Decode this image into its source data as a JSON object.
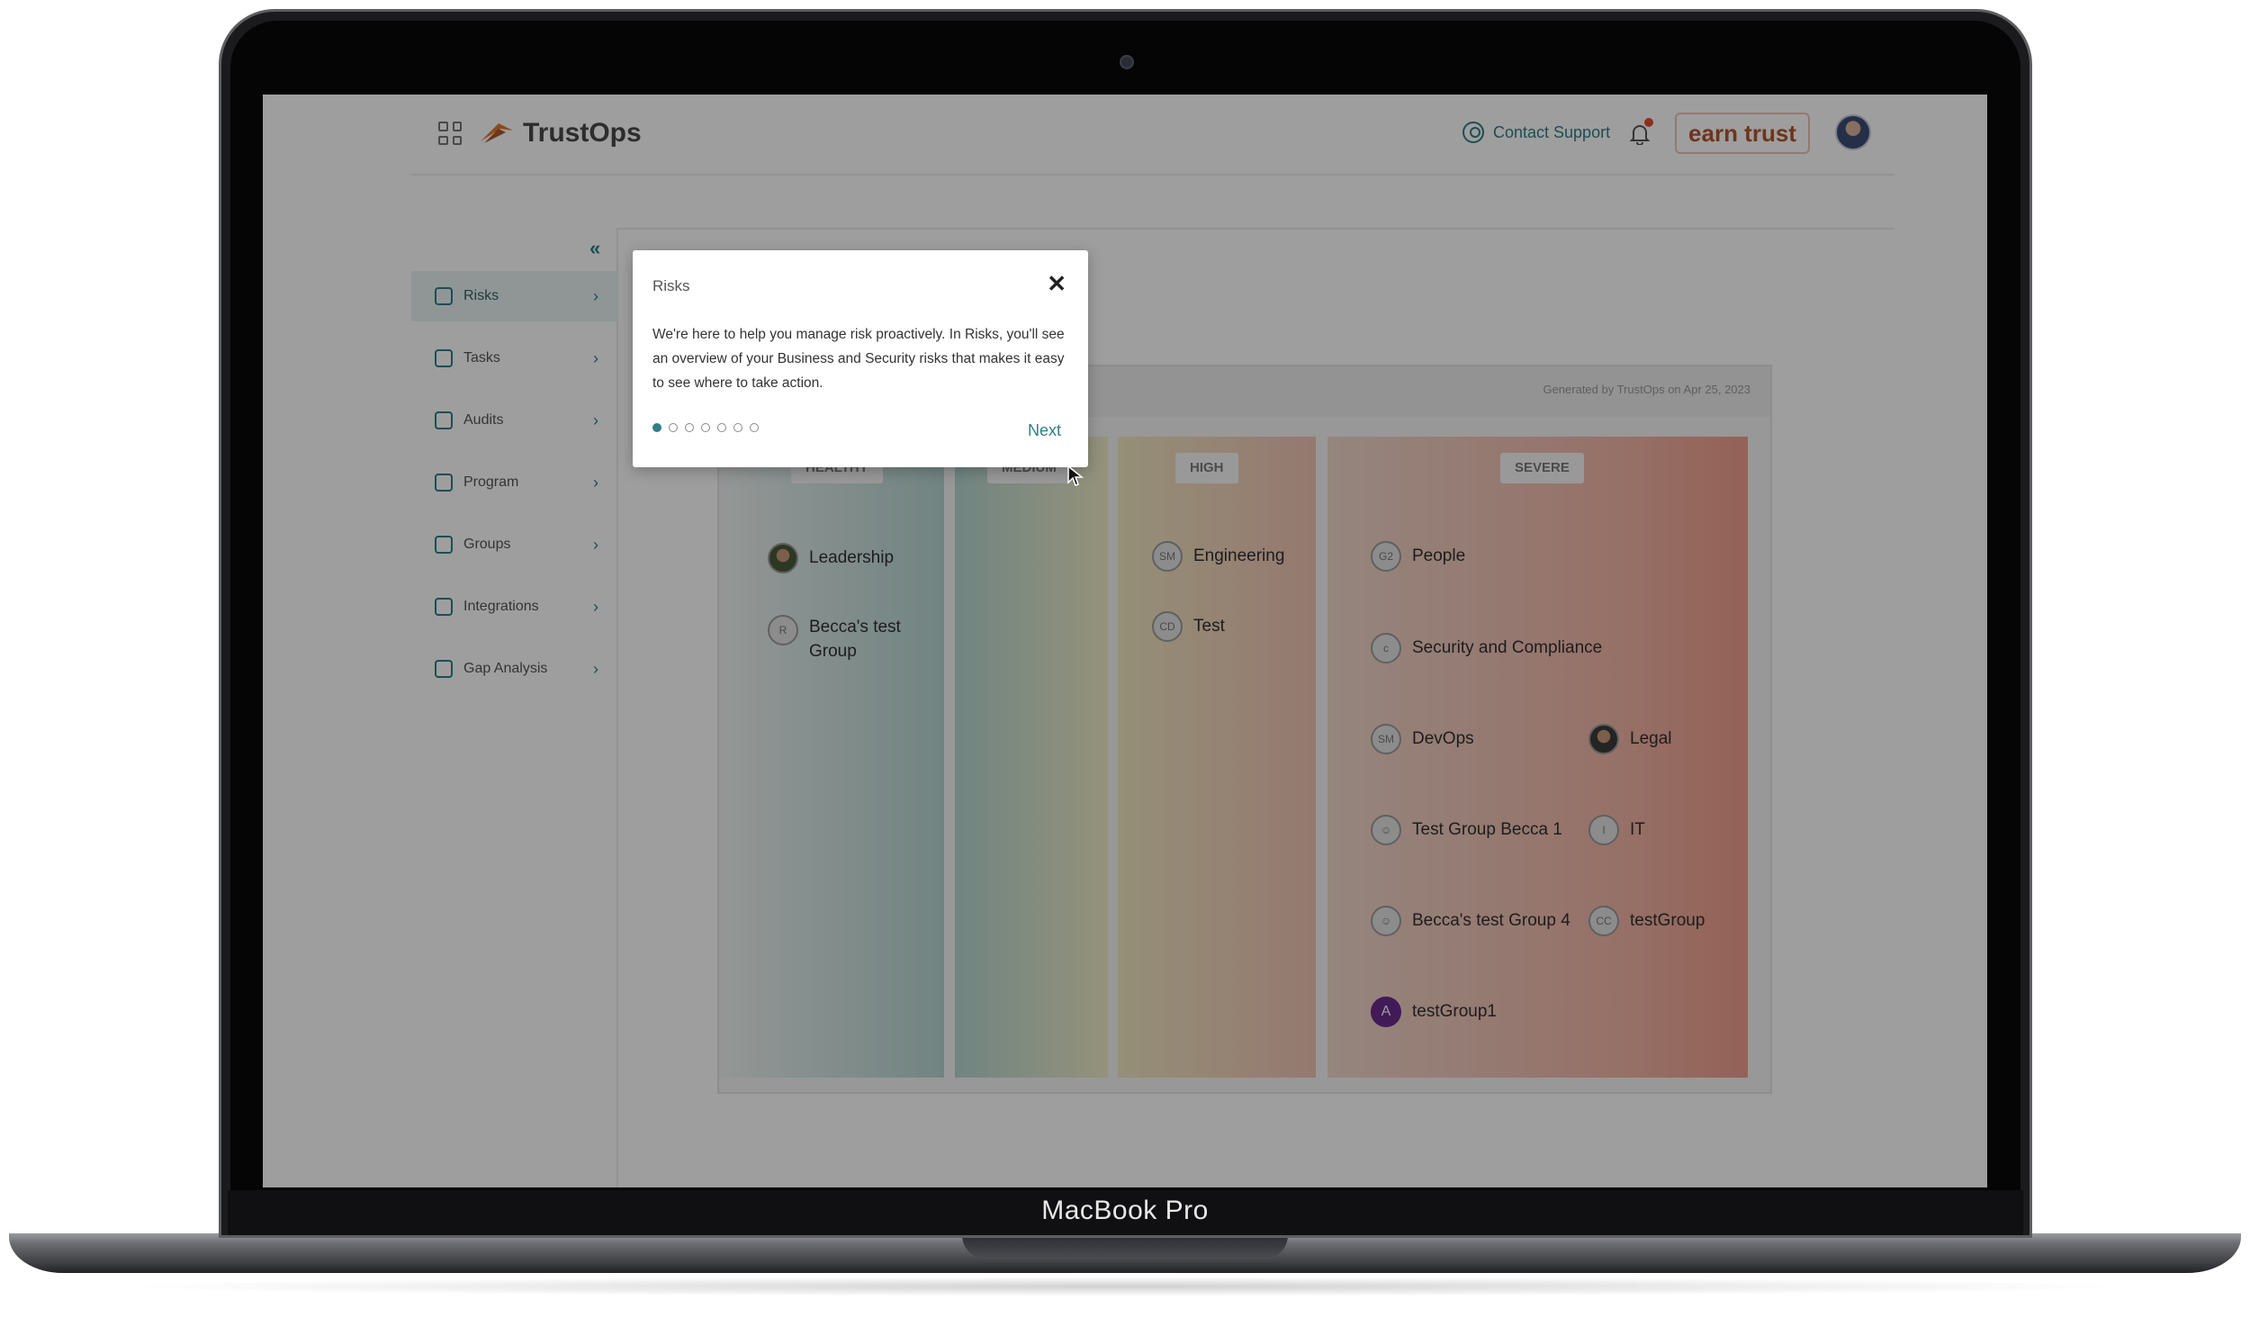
{
  "device": {
    "label": "MacBook Pro"
  },
  "app": {
    "name": "TrustOps",
    "contact_support": "Contact Support",
    "earn_trust": "earn trust"
  },
  "sidebar": {
    "collapse_icon": "double-chevron-left-icon",
    "items": [
      {
        "label": "Risks",
        "icon": "risk-icon",
        "active": true
      },
      {
        "label": "Tasks",
        "icon": "tasks-icon",
        "active": false
      },
      {
        "label": "Audits",
        "icon": "audits-icon",
        "active": false
      },
      {
        "label": "Program",
        "icon": "program-icon",
        "active": false
      },
      {
        "label": "Groups",
        "icon": "groups-icon",
        "active": false
      },
      {
        "label": "Integrations",
        "icon": "integrations-icon",
        "active": false
      },
      {
        "label": "Gap Analysis",
        "icon": "gap-analysis-icon",
        "active": false
      }
    ]
  },
  "heatmap": {
    "generated": "Generated by TrustOps on Apr 25, 2023",
    "columns": {
      "healthy": "HEALTHY",
      "medium": "MEDIUM",
      "high": "HIGH",
      "severe": "SEVERE"
    },
    "groups": {
      "leadership": {
        "name": "Leadership",
        "initials": ""
      },
      "becca_test_group": {
        "name": "Becca's test Group",
        "initials": "R"
      },
      "engineering": {
        "name": "Engineering",
        "initials": "SM"
      },
      "test": {
        "name": "Test",
        "initials": "CD"
      },
      "people": {
        "name": "People",
        "initials": "G2"
      },
      "security": {
        "name": "Security and Compliance",
        "initials": "c"
      },
      "devops": {
        "name": "DevOps",
        "initials": "SM"
      },
      "legal": {
        "name": "Legal",
        "initials": ""
      },
      "tgb1": {
        "name": "Test Group Becca 1",
        "initials": ""
      },
      "it": {
        "name": "IT",
        "initials": "I"
      },
      "btg4": {
        "name": "Becca's test Group 4",
        "initials": ""
      },
      "testgroup": {
        "name": "testGroup",
        "initials": "CC"
      },
      "testgroup1": {
        "name": "testGroup1",
        "initials": "A"
      }
    }
  },
  "tour": {
    "title": "Risks",
    "body": "We're here to help you manage risk proactively. In Risks, you'll see an overview of your Business and Security risks that makes it easy to see where to take action.",
    "next": "Next",
    "step": 1,
    "total_steps": 7
  },
  "colors": {
    "accent": "#2f7f86",
    "brand": "#b4552d"
  }
}
